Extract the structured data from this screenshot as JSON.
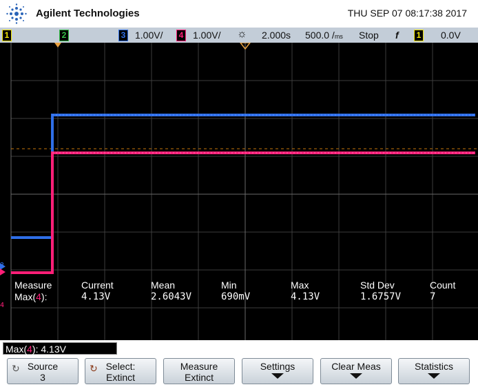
{
  "header": {
    "brand": "Agilent Technologies",
    "datetime": "THU SEP 07 08:17:38 2017"
  },
  "status": {
    "ch1": "1",
    "ch2": "2",
    "ch3": "3",
    "ch4": "4",
    "ch3_scale": "1.00V/",
    "ch4_scale": "1.00V/",
    "timebase": "2.000s",
    "sample_rate": "500.0 /",
    "sample_rate_unit": "ms",
    "run_state": "Stop",
    "trig_symbol": "f",
    "trig_src": "1",
    "trig_level": "0.0V"
  },
  "colors": {
    "ch1": "#f2e600",
    "ch2": "#36c24a",
    "ch3": "#2f6fe8",
    "ch4": "#ff1f78",
    "statusbar": "#c3cdd8"
  },
  "screen": {
    "ch3_marker": "3",
    "ch4_marker": "4"
  },
  "measure": {
    "headers": [
      "Measure",
      "Current",
      "Mean",
      "Min",
      "Max",
      "Std Dev",
      "Count"
    ],
    "row_label": "Max(",
    "row_ch": "4",
    "row_suffix": "):",
    "values": [
      "4.13V",
      "2.6043V",
      "690mV",
      "4.13V",
      "1.6757V",
      "7"
    ]
  },
  "readout": {
    "prefix": "Max(",
    "ch": "4",
    "suffix": "): 4.13V"
  },
  "softkeys": {
    "source_l1": "Source",
    "source_l2": "3",
    "select_l1": "Select:",
    "select_l2": "Extinct",
    "measure_l1": "Measure",
    "measure_l2": "Extinct",
    "settings": "Settings",
    "clear": "Clear Meas",
    "stats": "Statistics"
  }
}
